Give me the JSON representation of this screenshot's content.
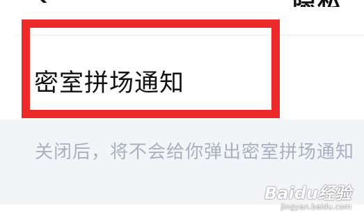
{
  "nav": {
    "title": "隐私"
  },
  "setting": {
    "label": "密室拼场通知",
    "description": "关闭后，将不会给你弹出密室拼场通知"
  },
  "highlight": {
    "color": "#ee2b2b"
  },
  "watermark": {
    "brand": "Baidu经验",
    "sub": "jingyan.baidu.com"
  }
}
